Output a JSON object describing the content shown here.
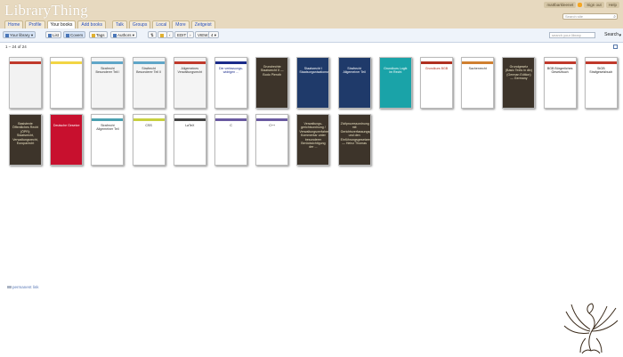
{
  "header": {
    "logo": "LibraryThing",
    "username": "mattbarkleenet",
    "sign_out": "Sign out",
    "help": "Help",
    "search_placeholder": "Search site"
  },
  "nav": {
    "home": "Home",
    "profile": "Profile",
    "your_books": "Your books",
    "add_books": "Add books",
    "talk": "Talk",
    "groups": "Groups",
    "local": "Local",
    "more": "More",
    "zeitgeist": "Zeitgeist"
  },
  "toolbar": {
    "your_library": "Your library",
    "list": "List",
    "covers": "Covers",
    "tags": "Tags",
    "authors": "Authors",
    "edit": "EDIT",
    "view_label": "VIEW",
    "view_value": "4",
    "library_search_placeholder": "search your library",
    "search": "Search"
  },
  "count_text": "1 – 24 of 24",
  "permalink": "permanent link",
  "colors": {
    "header_bg": "#e7d9bf",
    "toolbar_bg": "#eef3fa",
    "link": "#2a52be"
  },
  "covers": [
    {
      "title": "",
      "bg": "#f2f2f2",
      "fg": "#333333",
      "band": "#c0392b"
    },
    {
      "title": "",
      "bg": "#ffffff",
      "fg": "#333333",
      "band": "#f2d544"
    },
    {
      "title": "Strafrecht Besonderer Teil I",
      "bg": "#f4f4f4",
      "fg": "#333333",
      "band": "#5fa6c8"
    },
    {
      "title": "Strafrecht Besonderer Teil II",
      "bg": "#f4f4f4",
      "fg": "#333333",
      "band": "#5fa6c8"
    },
    {
      "title": "Allgemeines Verwaltungsrecht",
      "bg": "#f4f4f4",
      "fg": "#333333",
      "band": "#c0392b"
    },
    {
      "title": "Die verfassungs­widrigen ...",
      "bg": "#ffffff",
      "fg": "#1a2b8a",
      "band": "#1a2b8a"
    },
    {
      "title": "Grundrechte Staatsrecht II — Bodo Pieroth",
      "bg": "#3d342a",
      "fg": "#e8e0c0",
      "band": ""
    },
    {
      "title": "Staatsrecht I Staatsorganisationsrecht",
      "bg": "#1f3a6a",
      "fg": "#ffffff",
      "band": ""
    },
    {
      "title": "Strafrecht Allgemeiner Teil",
      "bg": "#1f3a6a",
      "fg": "#ffffff",
      "band": ""
    },
    {
      "title": "Grundkurs Logik im Recht",
      "bg": "#1aa3a8",
      "fg": "#ffffff",
      "band": ""
    },
    {
      "title": "Grundkurs BGB",
      "bg": "#ffffff",
      "fg": "#b03020",
      "band": "#b03020"
    },
    {
      "title": "Sachenrecht",
      "bg": "#ffffff",
      "fg": "#333333",
      "band": "#d08030"
    },
    {
      "title": "Grundgesetz (Basic Texts in dtv) (German Edition) — Germany",
      "bg": "#3d342a",
      "fg": "#e8e0c0",
      "band": ""
    },
    {
      "title": "BGB Bürgerliches Gesetzbuch",
      "bg": "#ffffff",
      "fg": "#222222",
      "band": "#c0392b"
    },
    {
      "title": "StGB Strafgesetzbuch",
      "bg": "#ffffff",
      "fg": "#222222",
      "band": "#c0392b"
    },
    {
      "title": "Basistexte Öffentliches Recht (ÖPR): Staatsrecht, Verwaltungsrecht, Europarecht",
      "bg": "#3d342a",
      "fg": "#e8e0c0",
      "band": ""
    },
    {
      "title": "Deutsche Gesetze",
      "bg": "#c8102e",
      "fg": "#ffffff",
      "band": ""
    },
    {
      "title": "Strafrecht Allgemeiner Teil",
      "bg": "#ffffff",
      "fg": "#333333",
      "band": "#4aa0b0"
    },
    {
      "title": "CSS",
      "bg": "#ffffff",
      "fg": "#222222",
      "band": "#c8d040"
    },
    {
      "title": "LaTeX",
      "bg": "#ffffff",
      "fg": "#222222",
      "band": "#444444"
    },
    {
      "title": "C",
      "bg": "#ffffff",
      "fg": "#222222",
      "band": "#6a5aa0"
    },
    {
      "title": "C++",
      "bg": "#ffffff",
      "fg": "#222222",
      "band": "#6a5aa0"
    },
    {
      "title": "Verwaltungs­gerichtsordnung / Verwaltungsverfahrensgesetz: Kommentar unter besonderer Berücksichtigung der ...",
      "bg": "#3d342a",
      "fg": "#e8e0c0",
      "band": ""
    },
    {
      "title": "Zivilprozessordnung mit Gerichtsverfassungsgesetz und den Einführungsgesetzen — Heinz Thomas",
      "bg": "#3d342a",
      "fg": "#e8e0c0",
      "band": ""
    }
  ]
}
